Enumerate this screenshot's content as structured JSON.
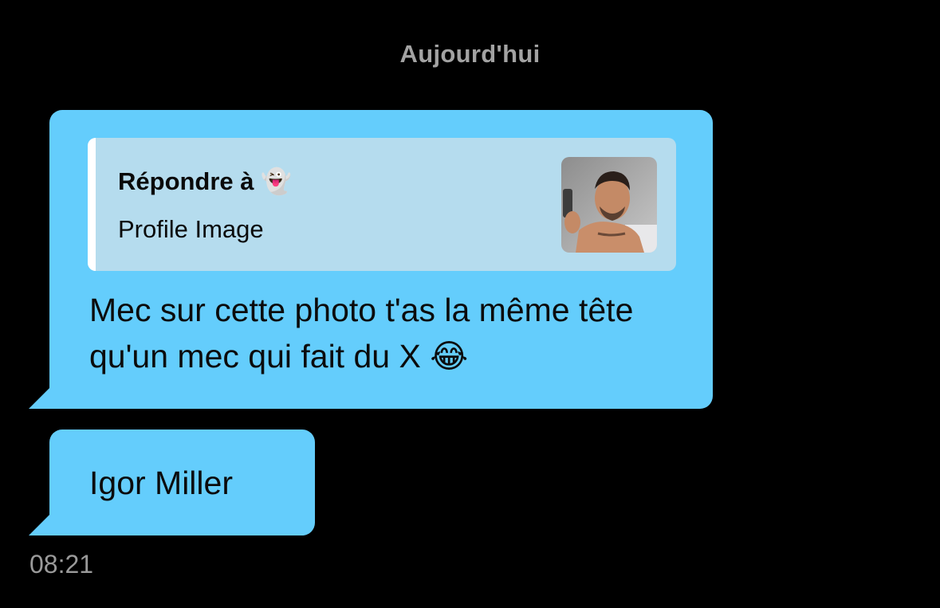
{
  "conversation": {
    "date_label": "Aujourd'hui",
    "messages": [
      {
        "reply": {
          "title": "Répondre à 👻",
          "subtitle": "Profile Image",
          "thumbnail_icon": "profile-photo"
        },
        "text": "Mec sur cette photo t'as la même tête qu'un mec qui fait du X 😂"
      },
      {
        "text": "Igor Miller"
      }
    ],
    "timestamp": "08:21"
  },
  "colors": {
    "background": "#000000",
    "bubble": "#64cdfc",
    "reply_box": "#b5dcee",
    "date_label": "#a3a3a3",
    "timestamp": "#9a9a9a"
  }
}
